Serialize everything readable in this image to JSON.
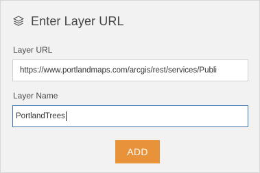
{
  "header": {
    "icon": "layers-icon",
    "title": "Enter Layer URL"
  },
  "form": {
    "url_label": "Layer URL",
    "url_value": "https://www.portlandmaps.com/arcgis/rest/services/Publi",
    "name_label": "Layer Name",
    "name_value": "PortlandTrees"
  },
  "actions": {
    "add_label": "ADD"
  },
  "colors": {
    "panel_background": "#f2f2f2",
    "accent_button": "#e8923a",
    "focused_border": "#3a6fb0"
  }
}
